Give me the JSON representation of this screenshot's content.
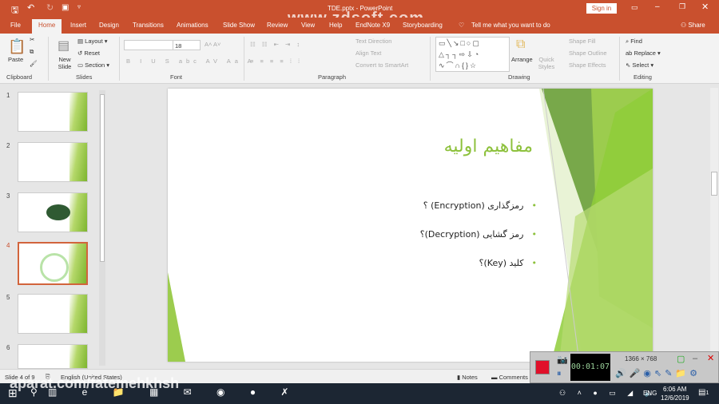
{
  "titlebar": {
    "title": "TDE.pptx - PowerPoint",
    "watermark": "www.zdsoft.com",
    "sign_in": "Sign in"
  },
  "tabs": [
    "File",
    "Home",
    "Insert",
    "Design",
    "Transitions",
    "Animations",
    "Slide Show",
    "Review",
    "View",
    "Help",
    "EndNote X9",
    "Storyboarding"
  ],
  "tell_me": "Tell me what you want to do",
  "share": "Share",
  "ribbon": {
    "paste": "Paste",
    "new_slide": "New Slide",
    "layout": "Layout",
    "reset": "Reset",
    "section": "Section",
    "font_size": "18",
    "text_direction": "Text Direction",
    "align_text": "Align Text",
    "convert_smartart": "Convert to SmartArt",
    "arrange": "Arrange",
    "quick_styles": "Quick Styles",
    "shape_fill": "Shape Fill",
    "shape_outline": "Shape Outline",
    "shape_effects": "Shape Effects",
    "find": "Find",
    "replace": "Replace",
    "select": "Select",
    "groups": {
      "clipboard": "Clipboard",
      "slides": "Slides",
      "font": "Font",
      "paragraph": "Paragraph",
      "drawing": "Drawing",
      "editing": "Editing"
    }
  },
  "thumbnails": [
    "1",
    "2",
    "3",
    "4",
    "5",
    "6"
  ],
  "slide": {
    "title": "مفاهیم اولیه",
    "bullets": [
      "رمزگذاری (Encryption) ؟",
      "رمز گشایی (Decryption)؟",
      "کلید (Key)؟"
    ]
  },
  "status": {
    "slide_of": "Slide 4 of 9",
    "language": "English (United States)",
    "notes": "Notes",
    "comments": "Comments"
  },
  "recorder": {
    "timer": "00:01:07",
    "resolution": "1366 × 768"
  },
  "taskbar": {
    "watermark": "aparat.com/fatemehkhsh",
    "lang": "ENG",
    "time": "6:06 AM",
    "date": "12/6/2019",
    "notif": "1"
  }
}
